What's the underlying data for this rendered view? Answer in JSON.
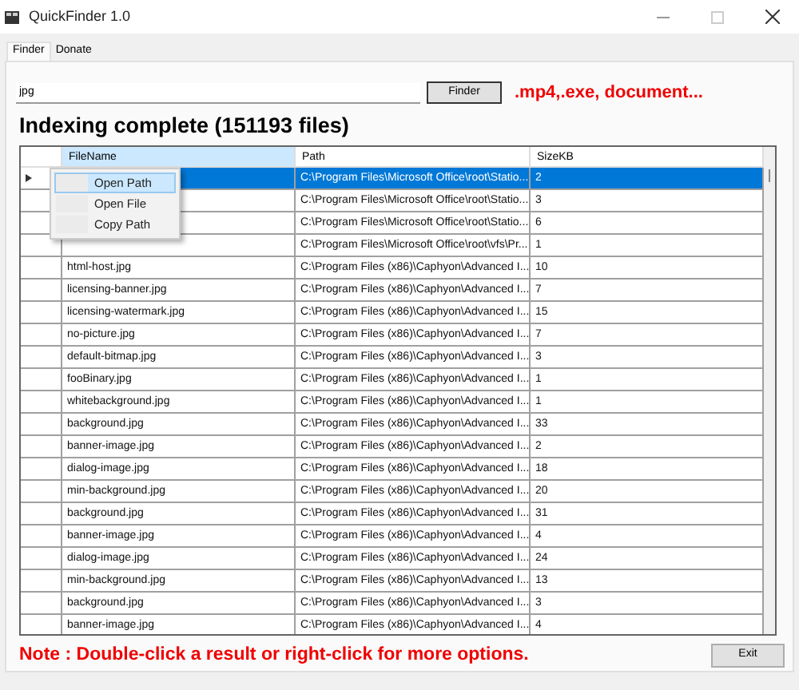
{
  "window": {
    "title": "QuickFinder 1.0"
  },
  "tabs": [
    {
      "label": "Finder",
      "selected": true
    },
    {
      "label": "Donate",
      "selected": false
    }
  ],
  "search": {
    "value": "jpg"
  },
  "finder_button": "Finder",
  "hint": ".mp4,.exe, document...",
  "status": "Indexing complete (151193 files)",
  "table": {
    "columns": [
      {
        "label": "FileName",
        "selected": true
      },
      {
        "label": "Path",
        "selected": false
      },
      {
        "label": "SizeKB",
        "selected": false
      }
    ],
    "rows": [
      {
        "selected": true,
        "path": "C:\\Program Files\\Microsoft Office\\root\\Statio...",
        "size": "2"
      },
      {
        "selected": false,
        "path": "C:\\Program Files\\Microsoft Office\\root\\Statio...",
        "size": "3"
      },
      {
        "selected": false,
        "path": "C:\\Program Files\\Microsoft Office\\root\\Statio...",
        "size": "6"
      },
      {
        "selected": false,
        "path": "C:\\Program Files\\Microsoft Office\\root\\vfs\\Pr...",
        "size": "1"
      },
      {
        "selected": false,
        "file": "html-host.jpg",
        "path": "C:\\Program Files (x86)\\Caphyon\\Advanced I...",
        "size": "10"
      },
      {
        "selected": false,
        "file": "licensing-banner.jpg",
        "path": "C:\\Program Files (x86)\\Caphyon\\Advanced I...",
        "size": "7"
      },
      {
        "selected": false,
        "file": "licensing-watermark.jpg",
        "path": "C:\\Program Files (x86)\\Caphyon\\Advanced I...",
        "size": "15"
      },
      {
        "selected": false,
        "file": "no-picture.jpg",
        "path": "C:\\Program Files (x86)\\Caphyon\\Advanced I...",
        "size": "7"
      },
      {
        "selected": false,
        "file": "default-bitmap.jpg",
        "path": "C:\\Program Files (x86)\\Caphyon\\Advanced I...",
        "size": "3"
      },
      {
        "selected": false,
        "file": "fooBinary.jpg",
        "path": "C:\\Program Files (x86)\\Caphyon\\Advanced I...",
        "size": "1"
      },
      {
        "selected": false,
        "file": "whitebackground.jpg",
        "path": "C:\\Program Files (x86)\\Caphyon\\Advanced I...",
        "size": "1"
      },
      {
        "selected": false,
        "file": "background.jpg",
        "path": "C:\\Program Files (x86)\\Caphyon\\Advanced I...",
        "size": "33"
      },
      {
        "selected": false,
        "file": "banner-image.jpg",
        "path": "C:\\Program Files (x86)\\Caphyon\\Advanced I...",
        "size": "2"
      },
      {
        "selected": false,
        "file": "dialog-image.jpg",
        "path": "C:\\Program Files (x86)\\Caphyon\\Advanced I...",
        "size": "18"
      },
      {
        "selected": false,
        "file": "min-background.jpg",
        "path": "C:\\Program Files (x86)\\Caphyon\\Advanced I...",
        "size": "20"
      },
      {
        "selected": false,
        "file": "background.jpg",
        "path": "C:\\Program Files (x86)\\Caphyon\\Advanced I...",
        "size": "31"
      },
      {
        "selected": false,
        "file": "banner-image.jpg",
        "path": "C:\\Program Files (x86)\\Caphyon\\Advanced I...",
        "size": "4"
      },
      {
        "selected": false,
        "file": "dialog-image.jpg",
        "path": "C:\\Program Files (x86)\\Caphyon\\Advanced I...",
        "size": "24"
      },
      {
        "selected": false,
        "file": "min-background.jpg",
        "path": "C:\\Program Files (x86)\\Caphyon\\Advanced I...",
        "size": "13"
      },
      {
        "selected": false,
        "file": "background.jpg",
        "path": "C:\\Program Files (x86)\\Caphyon\\Advanced I...",
        "size": "3"
      },
      {
        "selected": false,
        "file": "banner-image.jpg",
        "path": "C:\\Program Files (x86)\\Caphyon\\Advanced I...",
        "size": "4"
      }
    ]
  },
  "context_menu": [
    {
      "label": "Open Path",
      "selected": true
    },
    {
      "label": "Open File",
      "selected": false
    },
    {
      "label": "Copy Path",
      "selected": false
    }
  ],
  "note": "Note : Double-click a result or right-click for more options.",
  "exit_button": "Exit"
}
